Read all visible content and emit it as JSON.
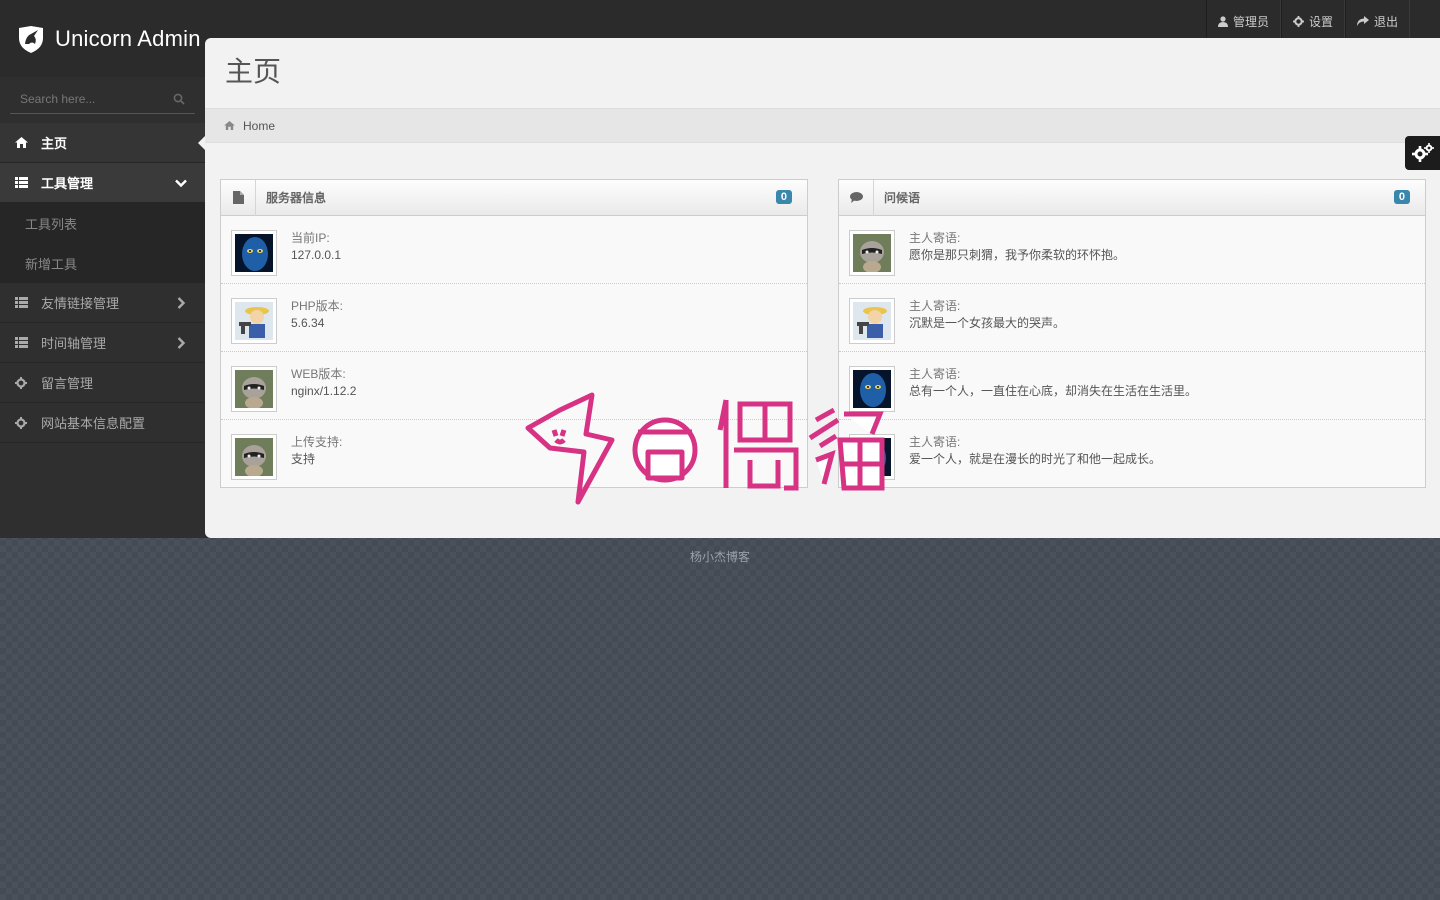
{
  "app": {
    "title": "Unicorn Admin"
  },
  "user_nav": [
    {
      "label": "管理员",
      "icon": "user-icon"
    },
    {
      "label": "设置",
      "icon": "gear-icon"
    },
    {
      "label": "退出",
      "icon": "share-icon"
    }
  ],
  "search": {
    "placeholder": "Search here..."
  },
  "sidebar": {
    "items": [
      {
        "label": "主页",
        "icon": "home-icon",
        "active": true
      },
      {
        "label": "工具管理",
        "icon": "list-icon",
        "open": true
      },
      {
        "label": "友情链接管理",
        "icon": "list-icon"
      },
      {
        "label": "时间轴管理",
        "icon": "list-icon"
      },
      {
        "label": "留言管理",
        "icon": "gear-icon"
      },
      {
        "label": "网站基本信息配置",
        "icon": "gear-icon"
      }
    ],
    "submenu": [
      {
        "label": "工具列表"
      },
      {
        "label": "新增工具"
      }
    ]
  },
  "page": {
    "title": "主页",
    "breadcrumb": "Home"
  },
  "server_widget": {
    "title": "服务器信息",
    "badge": "0",
    "items": [
      {
        "label": "当前IP:",
        "value": "127.0.0.1",
        "avatar": "blue-face"
      },
      {
        "label": "PHP版本:",
        "value": "5.6.34",
        "avatar": "vault-boy"
      },
      {
        "label": "WEB版本:",
        "value": "nginx/1.12.2",
        "avatar": "raccoon"
      },
      {
        "label": "上传支持:",
        "value": "支持",
        "avatar": "raccoon"
      }
    ]
  },
  "greeting_widget": {
    "title": "问候语",
    "badge": "0",
    "items": [
      {
        "label": "主人寄语:",
        "value": "愿你是那只刺猬，我予你柔软的环怀抱。",
        "avatar": "raccoon"
      },
      {
        "label": "主人寄语:",
        "value": "沉默是一个女孩最大的哭声。",
        "avatar": "vault-boy"
      },
      {
        "label": "主人寄语:",
        "value": "总有一个人，一直住在心底，却消失在生活在生活里。",
        "avatar": "blue-face"
      },
      {
        "label": "主人寄语:",
        "value": "爱一个人，就是在漫长的时光了和他一起成长。",
        "avatar": "blue-face"
      }
    ]
  },
  "footer": {
    "text": "杨小杰博客"
  },
  "watermark": {
    "text": "奇偶猫"
  },
  "colors": {
    "badge": "#3a87ad",
    "watermark": "#d63384"
  }
}
